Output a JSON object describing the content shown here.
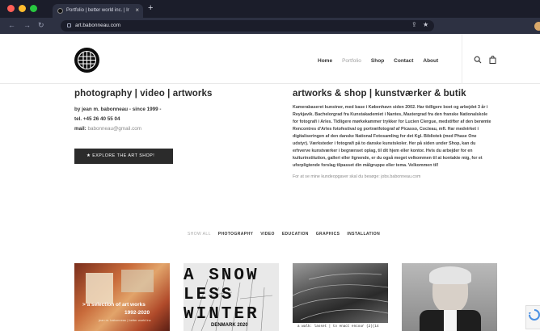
{
  "browser": {
    "tab_title": "Portfolio | better world inc. | Ir",
    "tab_close": "×",
    "new_tab": "+",
    "url": "art.babonneau.com",
    "colors": {
      "close": "#ff5f57",
      "min": "#febc2e",
      "max": "#28c840"
    }
  },
  "site": {
    "nav": [
      {
        "label": "Home",
        "active": false
      },
      {
        "label": "Portfolio",
        "active": true
      },
      {
        "label": "Shop",
        "active": false
      },
      {
        "label": "Contact",
        "active": false
      },
      {
        "label": "About",
        "active": false
      }
    ]
  },
  "intro": {
    "heading": "photography | video | artworks",
    "byline": "by jean m. babonneau - since 1999 -",
    "tel": "tel. +45 26 40 55 04",
    "mail_label": "mail:",
    "mail_value": "babonneau@gmail.com",
    "shop_button": "★  EXPLORE THE ART SHOP!"
  },
  "about": {
    "heading": "artworks & shop | kunstværker & butik",
    "paragraph": "Kamerabaseret kunstner, med base i København siden 2002. Har tidligere boet og arbejdet 3 år i Reykjavik. Bachelorgrad fra Kunstakademiet i Nantes, Mastergrad fra den franske Nationalskole for fotografi i Arles. Tidligere mørkekammer trykker for Lucien Clergue, medstifter af den berømte Rencontres d'Arles fotofestival og portrætfotograf af Picasso, Cocteau, mfl. Har medvirket i digitaliseringen af den danske National Fotosamling for det Kgl. Bibliotek (med Phase One udstyr). Værksteder i fotografi på to danske kunstskoler. Her på siden under Shop, kan du erhverve kunstværker i begrænset oplag, til dit hjem eller kontor. Hvis du arbejder for en kulturinstitution, galleri eller lignende, er du også meget velkommen til at kontakte mig, for et uforpligtende forslag tilpasset din målgruppe eller tema. Velkommen til!",
    "jobs_note": "For at se mine kundeopgaver skal du besøge: jobs.babonneau.com"
  },
  "filters": [
    "SHOW ALL",
    "PHOTOGRAPHY",
    "VIDEO",
    "EDUCATION",
    "GRAPHICS",
    "INSTALLATION"
  ],
  "thumbs": [
    {
      "line1": "> a selection of art works",
      "line2": "1992-2020",
      "line3": "jean m. babonneau | better world inc"
    },
    {
      "line1": "A SNOW",
      "line2": "LESS",
      "line3": "WINTER",
      "line4": "DENMARK 2020"
    },
    {
      "line1": "a walk: lasset | to enact encour (2)(14"
    },
    {
      "line1": ""
    }
  ]
}
